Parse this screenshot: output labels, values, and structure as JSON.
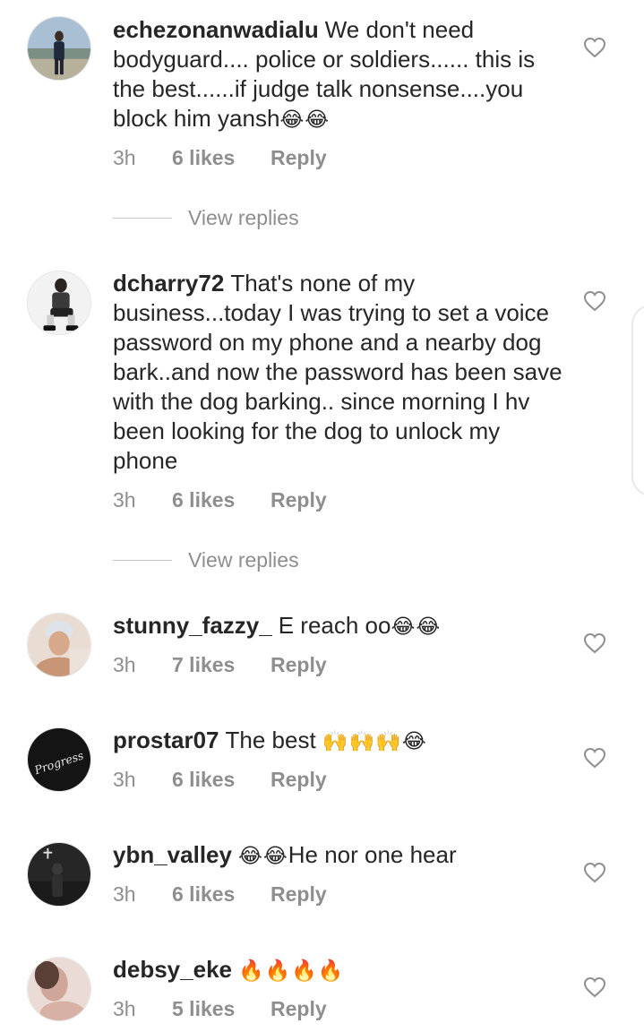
{
  "comments": [
    {
      "username": "echezonanwadialu",
      "text": "We don't need bodyguard.... police or soldiers...... this is the best......if judge talk nonsense....you block him yansh",
      "emoji": "😂😂",
      "time": "3h",
      "likes": "6 likes",
      "reply": "Reply",
      "view_replies": "View replies"
    },
    {
      "username": "dcharry72",
      "text": "That's none of my business...today I was trying to set a voice password on my phone and a nearby dog bark..and now the password has been save with the dog barking.. since morning I hv been looking for the dog to unlock my phone",
      "emoji": "",
      "time": "3h",
      "likes": "6 likes",
      "reply": "Reply",
      "view_replies": "View replies"
    },
    {
      "username": "stunny_fazzy_",
      "text": "E reach oo",
      "emoji": "😂😂",
      "time": "3h",
      "likes": "7 likes",
      "reply": "Reply"
    },
    {
      "username": "prostar07",
      "text": "The best",
      "emoji": "🙌🙌🙌😂",
      "time": "3h",
      "likes": "6 likes",
      "reply": "Reply",
      "avatar_text": "Progress"
    },
    {
      "username": "ybn_valley",
      "text": "He nor one hear",
      "emoji_before": "😂😂",
      "time": "3h",
      "likes": "6 likes",
      "reply": "Reply"
    },
    {
      "username": "debsy_eke",
      "text": "",
      "emoji": "🔥🔥🔥🔥",
      "time": "3h",
      "likes": "5 likes",
      "reply": "Reply"
    }
  ],
  "icons": {
    "like": "heart-outline-icon"
  },
  "colors": {
    "text": "#262626",
    "muted": "#8e8e8e"
  }
}
